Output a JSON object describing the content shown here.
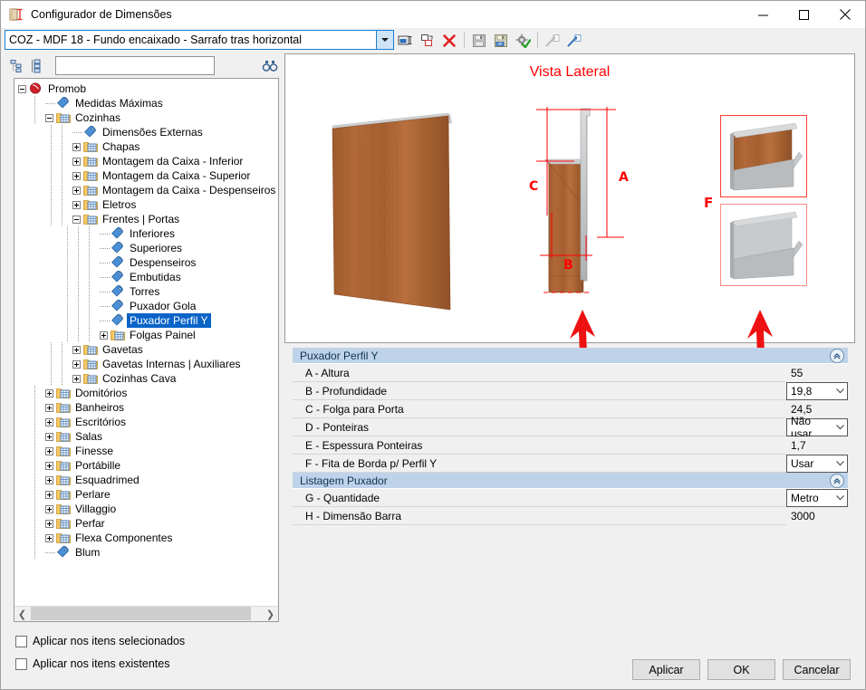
{
  "window": {
    "title": "Configurador de Dimensões",
    "icon": "dimension-config-icon",
    "minimize_label": "–",
    "maximize_label": "☐",
    "close_label": "✕"
  },
  "topbar": {
    "model_value": "COZ - MDF 18 - Fundo encaixado - Sarrafo tras horizontal",
    "toolbar_icons": [
      "rename-icon",
      "duplicate-icon",
      "delete-icon",
      "save-icon",
      "save-as-icon",
      "apply-settings-icon",
      "export-icon",
      "import-icon"
    ]
  },
  "tree_toolbar": {
    "expand_all_icon": "expand-all-icon",
    "collapse_all_icon": "collapse-all-icon",
    "search_value": "",
    "search_placeholder": "",
    "find_icon": "binoculars-find-icon"
  },
  "tree": {
    "nodes": [
      {
        "label": "Promob",
        "depth": 0,
        "expander": "minus",
        "icon": "promob-icon",
        "selected": false
      },
      {
        "label": "Medidas Máximas",
        "depth": 1,
        "expander": "none",
        "icon": "tag-icon",
        "selected": false
      },
      {
        "label": "Cozinhas",
        "depth": 1,
        "expander": "minus",
        "icon": "folder-icon",
        "selected": false
      },
      {
        "label": "Dimensões Externas",
        "depth": 2,
        "expander": "none",
        "icon": "tag-icon",
        "selected": false
      },
      {
        "label": "Chapas",
        "depth": 2,
        "expander": "plus",
        "icon": "folder-icon",
        "selected": false
      },
      {
        "label": "Montagem da Caixa - Inferior",
        "depth": 2,
        "expander": "plus",
        "icon": "folder-icon",
        "selected": false
      },
      {
        "label": "Montagem da Caixa - Superior",
        "depth": 2,
        "expander": "plus",
        "icon": "folder-icon",
        "selected": false
      },
      {
        "label": "Montagem da Caixa - Despenseiros | Torres",
        "depth": 2,
        "expander": "plus",
        "icon": "folder-icon",
        "selected": false
      },
      {
        "label": "Eletros",
        "depth": 2,
        "expander": "plus",
        "icon": "folder-icon",
        "selected": false
      },
      {
        "label": "Frentes | Portas",
        "depth": 2,
        "expander": "minus",
        "icon": "folder-icon",
        "selected": false
      },
      {
        "label": "Inferiores",
        "depth": 3,
        "expander": "none",
        "icon": "tag-icon",
        "selected": false
      },
      {
        "label": "Superiores",
        "depth": 3,
        "expander": "none",
        "icon": "tag-icon",
        "selected": false
      },
      {
        "label": "Despenseiros",
        "depth": 3,
        "expander": "none",
        "icon": "tag-icon",
        "selected": false
      },
      {
        "label": "Embutidas",
        "depth": 3,
        "expander": "none",
        "icon": "tag-icon",
        "selected": false
      },
      {
        "label": "Torres",
        "depth": 3,
        "expander": "none",
        "icon": "tag-icon",
        "selected": false
      },
      {
        "label": "Puxador Gola",
        "depth": 3,
        "expander": "none",
        "icon": "tag-icon",
        "selected": false
      },
      {
        "label": "Puxador Perfil Y",
        "depth": 3,
        "expander": "none",
        "icon": "tag-icon",
        "selected": true
      },
      {
        "label": "Folgas Painel",
        "depth": 3,
        "expander": "plus",
        "icon": "folder-icon",
        "selected": false
      },
      {
        "label": "Gavetas",
        "depth": 2,
        "expander": "plus",
        "icon": "folder-icon",
        "selected": false
      },
      {
        "label": "Gavetas Internas | Auxiliares",
        "depth": 2,
        "expander": "plus",
        "icon": "folder-icon",
        "selected": false
      },
      {
        "label": "Cozinhas Cava",
        "depth": 2,
        "expander": "plus",
        "icon": "folder-icon",
        "selected": false
      },
      {
        "label": "Domitórios",
        "depth": 1,
        "expander": "plus",
        "icon": "folder-icon",
        "selected": false
      },
      {
        "label": "Banheiros",
        "depth": 1,
        "expander": "plus",
        "icon": "folder-icon",
        "selected": false
      },
      {
        "label": "Escritórios",
        "depth": 1,
        "expander": "plus",
        "icon": "folder-icon",
        "selected": false
      },
      {
        "label": "Salas",
        "depth": 1,
        "expander": "plus",
        "icon": "folder-icon",
        "selected": false
      },
      {
        "label": "Finesse",
        "depth": 1,
        "expander": "plus",
        "icon": "folder-icon",
        "selected": false
      },
      {
        "label": "Portábille",
        "depth": 1,
        "expander": "plus",
        "icon": "folder-icon",
        "selected": false
      },
      {
        "label": "Esquadrimed",
        "depth": 1,
        "expander": "plus",
        "icon": "folder-icon",
        "selected": false
      },
      {
        "label": "Perlare",
        "depth": 1,
        "expander": "plus",
        "icon": "folder-icon",
        "selected": false
      },
      {
        "label": "Villaggio",
        "depth": 1,
        "expander": "plus",
        "icon": "folder-icon",
        "selected": false
      },
      {
        "label": "Perfar",
        "depth": 1,
        "expander": "plus",
        "icon": "folder-icon",
        "selected": false
      },
      {
        "label": "Flexa Componentes",
        "depth": 1,
        "expander": "plus",
        "icon": "folder-icon",
        "selected": false
      },
      {
        "label": "Blum",
        "depth": 1,
        "expander": "none",
        "icon": "tag-icon",
        "selected": false
      }
    ],
    "hscroll_left_icon": "chevron-left-icon",
    "hscroll_right_icon": "chevron-right-icon"
  },
  "preview": {
    "title": "Vista Lateral",
    "title_color": "#ff0000",
    "dimension_labels": {
      "A": "A",
      "B": "B",
      "C": "C",
      "F": "F"
    },
    "annotation_arrows": 2,
    "annotation_color": "#ee1111"
  },
  "properties": {
    "groups": [
      {
        "title": "Puxador Perfil Y",
        "collapse_icon": "collapse-chevrons-icon",
        "rows": [
          {
            "name": "A - Altura",
            "value": "55",
            "type": "text"
          },
          {
            "name": "B - Profundidade",
            "value": "19,8",
            "type": "combo"
          },
          {
            "name": "C - Folga para Porta",
            "value": "24,5",
            "type": "text"
          },
          {
            "name": "D - Ponteiras",
            "value": "Não usar",
            "type": "combo"
          },
          {
            "name": "E - Espessura Ponteiras",
            "value": "1,7",
            "type": "text"
          },
          {
            "name": "F - Fita de Borda p/ Perfil Y",
            "value": "Usar",
            "type": "combo"
          }
        ]
      },
      {
        "title": "Listagem Puxador",
        "collapse_icon": "collapse-chevrons-icon",
        "rows": [
          {
            "name": "G - Quantidade",
            "value": "Metro",
            "type": "combo"
          },
          {
            "name": "H - Dimensão Barra",
            "value": "3000",
            "type": "text"
          }
        ]
      }
    ]
  },
  "footer": {
    "checkboxes": [
      {
        "label": "Aplicar nos itens selecionados",
        "checked": false
      },
      {
        "label": "Aplicar nos itens existentes",
        "checked": false
      }
    ],
    "buttons": [
      {
        "label": "Aplicar",
        "name": "apply-button"
      },
      {
        "label": "OK",
        "name": "ok-button"
      },
      {
        "label": "Cancelar",
        "name": "cancel-button"
      }
    ]
  }
}
